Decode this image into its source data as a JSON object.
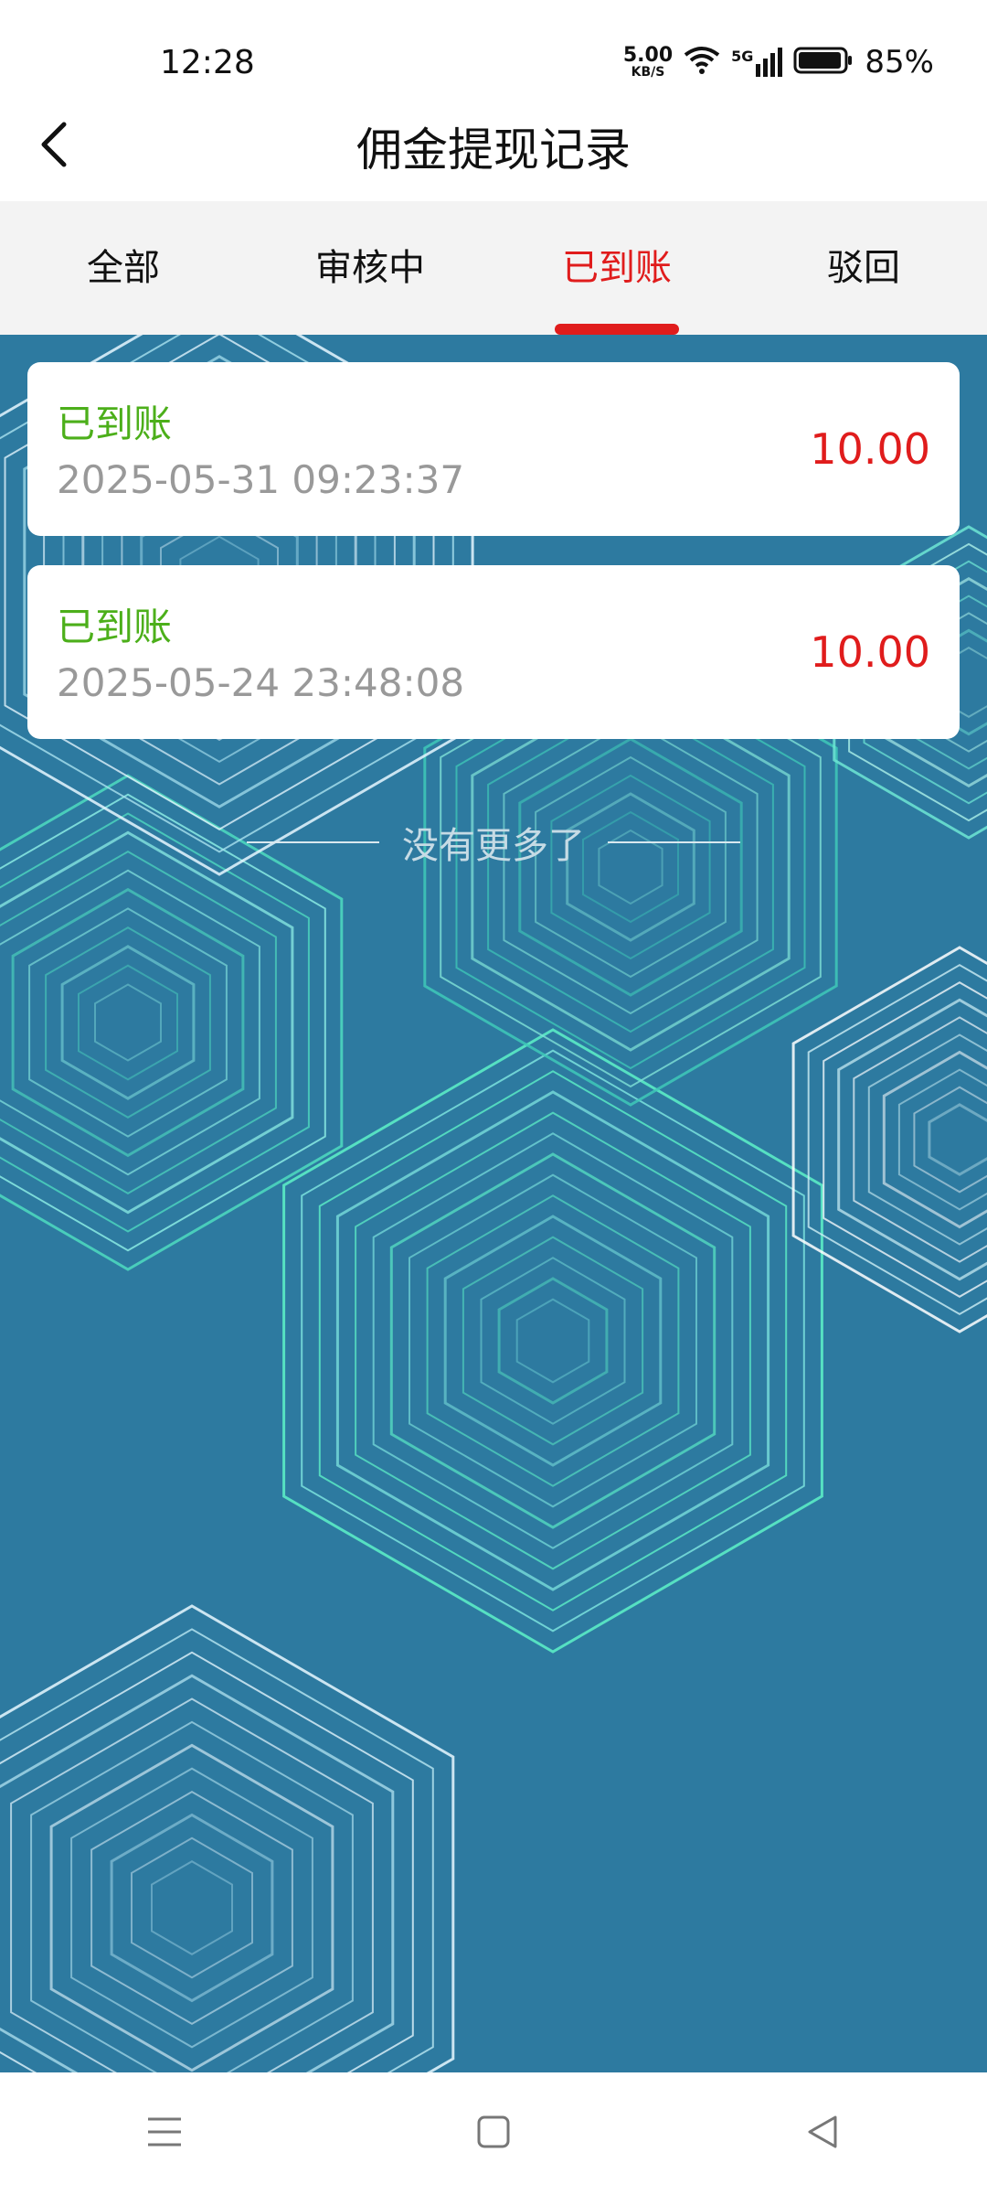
{
  "status_bar": {
    "time": "12:28",
    "net_speed": "5.00",
    "net_unit": "KB/S",
    "signal_label": "5G",
    "battery": "85%"
  },
  "header": {
    "title": "佣金提现记录"
  },
  "tabs": [
    {
      "label": "全部"
    },
    {
      "label": "审核中"
    },
    {
      "label": "已到账"
    },
    {
      "label": "驳回"
    }
  ],
  "active_tab": "已到账",
  "records": [
    {
      "status": "已到账",
      "time": "2025-05-31 09:23:37",
      "amount": "10.00"
    },
    {
      "status": "已到账",
      "time": "2025-05-24 23:48:08",
      "amount": "10.00"
    }
  ],
  "footer_text": "没有更多了",
  "colors": {
    "accent": "#e01c1c",
    "success": "#4caf1a",
    "background": "#2d7aa0"
  },
  "icons": {
    "back": "chevron-left-icon",
    "menu": "menu-icon",
    "home": "home-square-icon",
    "recent": "back-triangle-icon"
  }
}
